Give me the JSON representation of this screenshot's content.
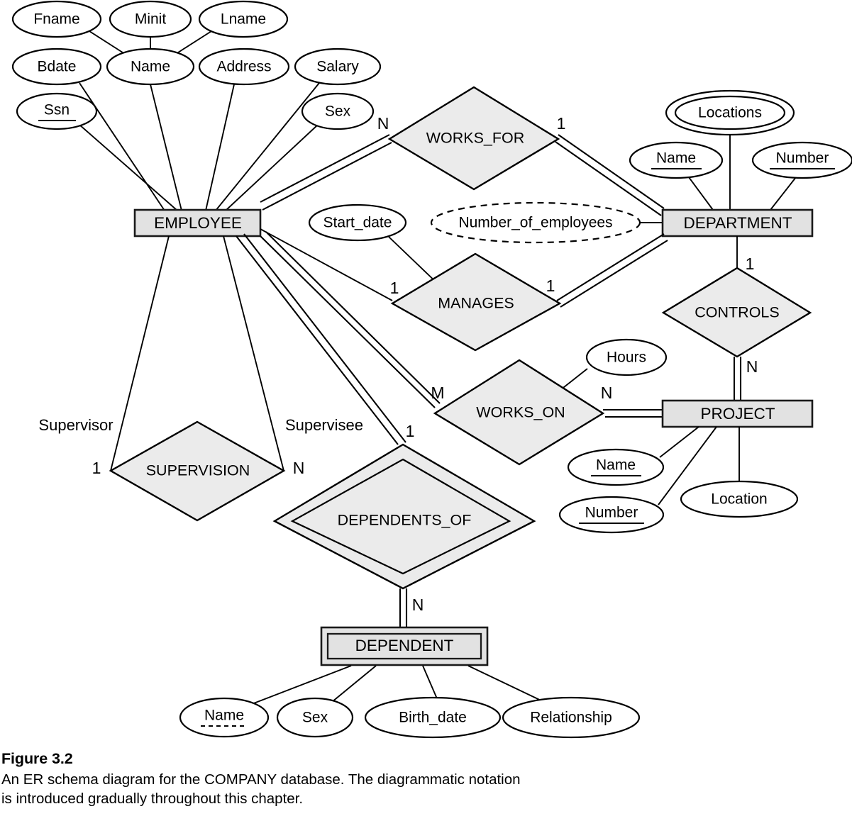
{
  "figure": {
    "title": "Figure 3.2",
    "caption_line1": "An ER schema diagram for the COMPANY database. The diagrammatic notation",
    "caption_line2": "is introduced gradually throughout this chapter."
  },
  "colors": {
    "entity_fill": "#e2e2e2",
    "relationship_fill": "#ebebeb",
    "attribute_fill": "#ffffff",
    "stroke": "#000000"
  },
  "entities": {
    "employee": "EMPLOYEE",
    "department": "DEPARTMENT",
    "project": "PROJECT",
    "dependent": "DEPENDENT"
  },
  "relationships": {
    "works_for": "WORKS_FOR",
    "manages": "MANAGES",
    "controls": "CONTROLS",
    "works_on": "WORKS_ON",
    "supervision": "SUPERVISION",
    "dependents_of": "DEPENDENTS_OF"
  },
  "attributes": {
    "employee": {
      "fname": "Fname",
      "minit": "Minit",
      "lname": "Lname",
      "bdate": "Bdate",
      "name": "Name",
      "address": "Address",
      "salary": "Salary",
      "ssn": "Ssn",
      "sex": "Sex"
    },
    "department": {
      "locations": "Locations",
      "name": "Name",
      "number": "Number",
      "number_of_employees": "Number_of_employees"
    },
    "project": {
      "name": "Name",
      "number": "Number",
      "location": "Location"
    },
    "dependent": {
      "name": "Name",
      "sex": "Sex",
      "birth_date": "Birth_date",
      "relationship": "Relationship"
    },
    "manages": {
      "start_date": "Start_date"
    },
    "works_on": {
      "hours": "Hours"
    }
  },
  "cardinalities": {
    "works_for_employee": "N",
    "works_for_department": "1",
    "manages_employee": "1",
    "manages_department": "1",
    "controls_department": "1",
    "controls_project": "N",
    "works_on_employee": "M",
    "works_on_project": "N",
    "supervision_supervisor": "1",
    "supervision_supervisee": "N",
    "dependents_of_employee": "1",
    "dependents_of_dependent": "N"
  },
  "roles": {
    "supervisor": "Supervisor",
    "supervisee": "Supervisee"
  }
}
